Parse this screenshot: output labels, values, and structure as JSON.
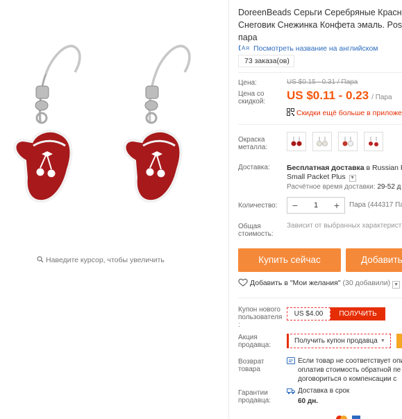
{
  "image_pane": {
    "zoom_hint": "Наведите курсор, чтобы увеличить"
  },
  "product": {
    "title": "DoreenBeads Серьги Серебряные Красный Снеговик Снежинка Конфета эмаль. Post: пара",
    "translate_link": "Посмотреть название на английском",
    "orders": "73 заказа(ов)"
  },
  "price": {
    "label": "Цена:",
    "original": "US $0.15 - 0.31 / Пара",
    "discount_label": "Цена со скидкой:",
    "current": "US $0.11 - 0.23",
    "unit": "/ Пара",
    "app_discount": "Скидки ещё больше в приложении"
  },
  "color": {
    "label": "Окраска металла:",
    "swatches": [
      "swatch-1",
      "swatch-2",
      "swatch-3",
      "swatch-4"
    ]
  },
  "shipping": {
    "label": "Доставка:",
    "free_text": "Бесплатная доставка",
    "dest_text": "в Russian Fe",
    "service": "Small Packet Plus",
    "time_label": "Расчётное время доставки:",
    "time_value": "29-52 д"
  },
  "quantity": {
    "label": "Количество:",
    "minus": "−",
    "value": "1",
    "plus": "+",
    "available": "Пара (444317 Па"
  },
  "total": {
    "label": "Общая стоимость:",
    "note": "Зависит от выбранных характерист"
  },
  "actions": {
    "buy_now": "Купить сейчас",
    "add_to_cart": "Добавить"
  },
  "wishlist": {
    "label": "Добавить в \"Мои желания\"",
    "count": "(30 добавили)"
  },
  "new_user_coupon": {
    "label": "Купон нового пользователя :",
    "amount": "US $4.00",
    "button": "ПОЛУЧИТЬ"
  },
  "seller_promo": {
    "label": "Акция продавца:",
    "button": "Получить купон продавца"
  },
  "returns": {
    "label": "Возврат товара",
    "text": "Если товар не соответствует опи оплатив стоимость обратной пе договориться о компенсации с"
  },
  "guarantee": {
    "label": "Гарантии продавца:",
    "delivery_text": "Доставка в срок",
    "delivery_days": "60 дн."
  },
  "colors": {
    "accent": "#f5560b",
    "button": "#f5893a",
    "red": "#e62e04",
    "link": "#2c6bbf"
  }
}
